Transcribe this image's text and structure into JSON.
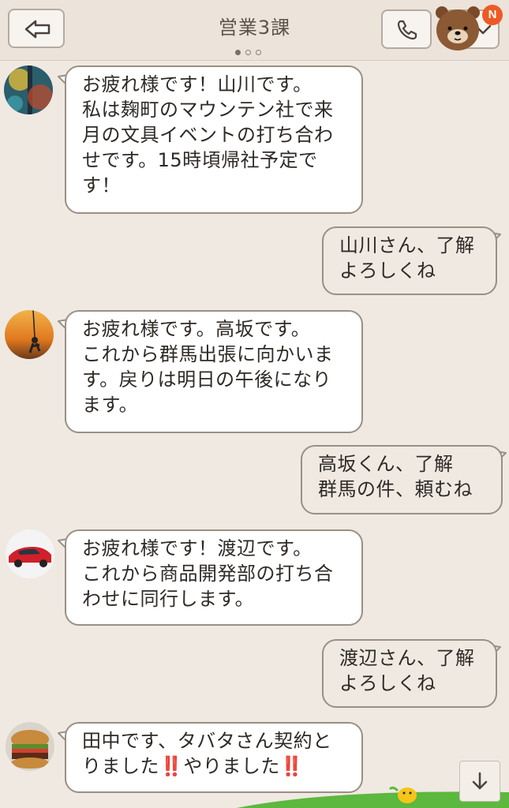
{
  "header": {
    "title": "営業3課",
    "page_dots": 3,
    "active_dot": 0,
    "notification_badge": "N",
    "icons": {
      "back": "back-arrow-icon",
      "call": "phone-icon",
      "menu": "chevron-down-icon",
      "profile": "bear-sticker-icon"
    }
  },
  "messages": [
    {
      "direction": "in",
      "avatar": "avatar-yamakawa",
      "text": "お疲れ様です！山川です。\n私は麹町のマウンテン社で来\n月の文具イベントの打ち合わ\nせです。15時頃帰社予定で\nす！"
    },
    {
      "direction": "out",
      "text": "山川さん、了解\nよろしくね"
    },
    {
      "direction": "in",
      "avatar": "avatar-takasaka",
      "text": "お疲れ様です。高坂です。\nこれから群馬出張に向かいま\nす。戻りは明日の午後になり\nます。"
    },
    {
      "direction": "out",
      "text": "高坂くん、了解\n群馬の件、頼むね"
    },
    {
      "direction": "in",
      "avatar": "avatar-watanabe",
      "text": "お疲れ様です！渡辺です。\nこれから商品開発部の打ち合\nわせに同行します。"
    },
    {
      "direction": "out",
      "text": "渡辺さん、了解\nよろしくね"
    },
    {
      "direction": "in",
      "avatar": "avatar-tanaka",
      "text": "田中です、タバタさん契約と\nりました‼️やりました‼️"
    }
  ],
  "colors": {
    "background": "#efe9e2",
    "header_bg": "#ece3da",
    "bubble_border": "#9b8f84",
    "badge": "#ee5a24"
  },
  "scroll_button_icon": "arrow-down-icon"
}
